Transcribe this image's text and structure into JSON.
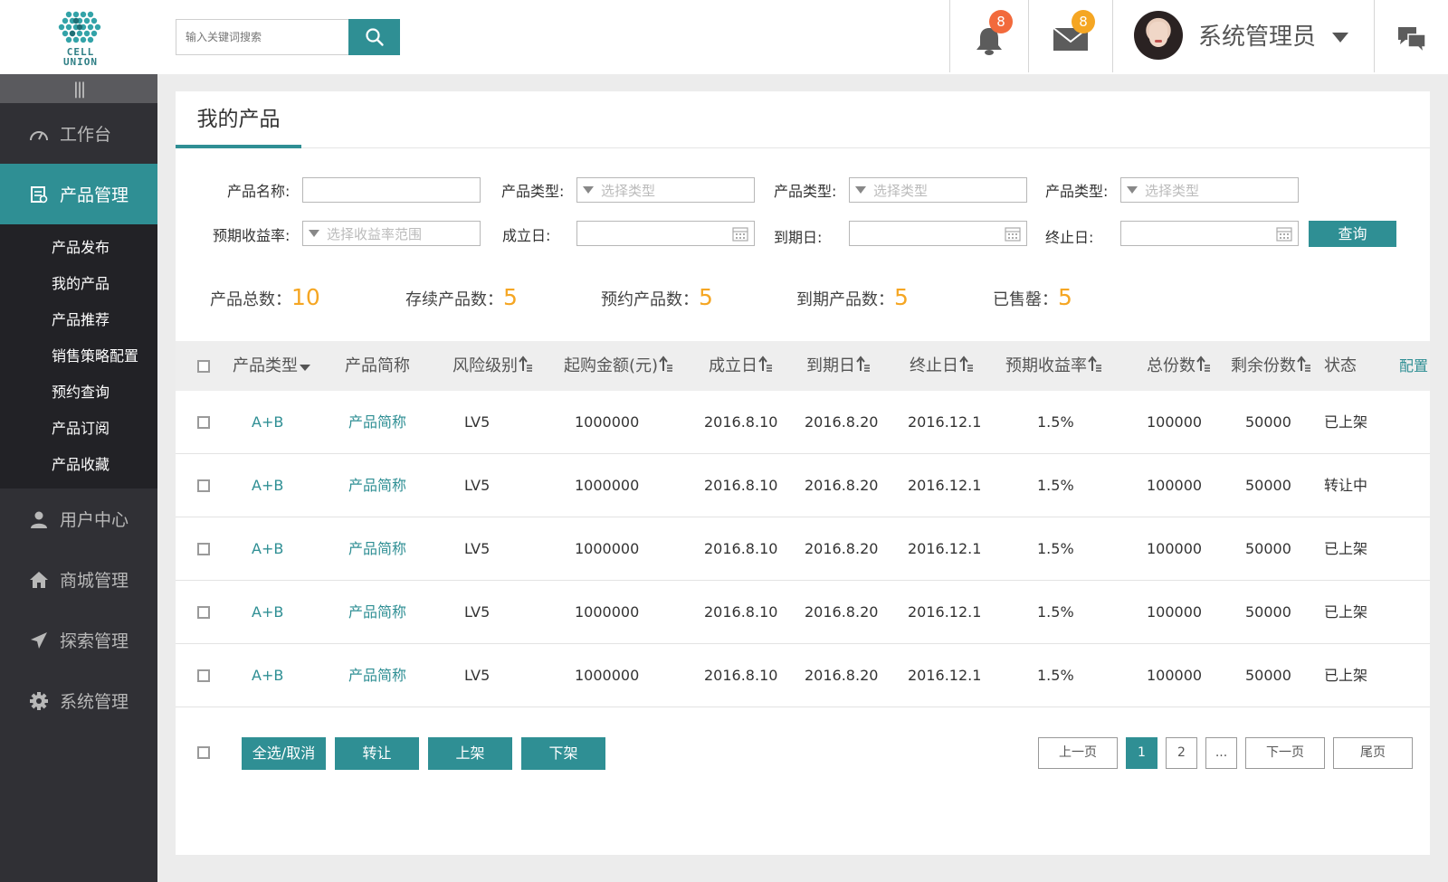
{
  "header": {
    "logo_text_1": "CELL",
    "logo_text_2": "UNION",
    "search_placeholder": "输入关键词搜索",
    "notifications_count": "8",
    "messages_count": "8",
    "user_name": "系统管理员"
  },
  "sidebar": {
    "items": [
      {
        "label": "工作台",
        "icon": "dashboard-icon"
      },
      {
        "label": "产品管理",
        "icon": "product-list-icon"
      },
      {
        "label": "用户中心",
        "icon": "user-icon"
      },
      {
        "label": "商城管理",
        "icon": "home-icon"
      },
      {
        "label": "探索管理",
        "icon": "send-icon"
      },
      {
        "label": "系统管理",
        "icon": "gear-icon"
      }
    ],
    "sub_items": [
      "产品发布",
      "我的产品",
      "产品推荐",
      "销售策略配置",
      "预约查询",
      "产品订阅",
      "产品收藏"
    ]
  },
  "page": {
    "title": "我的产品"
  },
  "filters": {
    "name_label": "产品名称:",
    "type_label": "产品类型:",
    "type_placeholder": "选择类型",
    "rate_label": "预期收益率:",
    "rate_placeholder": "选择收益率范围",
    "setup_label": "成立日:",
    "due_label": "到期日:",
    "end_label": "终止日:",
    "query_button": "查询"
  },
  "stats": [
    {
      "label": "产品总数：",
      "value": "10"
    },
    {
      "label": "存续产品数：",
      "value": "5"
    },
    {
      "label": "预约产品数：",
      "value": "5"
    },
    {
      "label": "到期产品数：",
      "value": "5"
    },
    {
      "label": "已售罄：",
      "value": "5"
    }
  ],
  "table": {
    "headers": [
      "产品类型",
      "产品简称",
      "风险级别",
      "起购金额(元)",
      "成立日",
      "到期日",
      "终止日",
      "预期收益率",
      "总份数",
      "剩余份数",
      "状态"
    ],
    "config_label": "配置",
    "rows": [
      [
        "A+B",
        "产品简称",
        "LV5",
        "1000000",
        "2016.8.10",
        "2016.8.20",
        "2016.12.1",
        "1.5%",
        "100000",
        "50000",
        "已上架"
      ],
      [
        "A+B",
        "产品简称",
        "LV5",
        "1000000",
        "2016.8.10",
        "2016.8.20",
        "2016.12.1",
        "1.5%",
        "100000",
        "50000",
        "转让中"
      ],
      [
        "A+B",
        "产品简称",
        "LV5",
        "1000000",
        "2016.8.10",
        "2016.8.20",
        "2016.12.1",
        "1.5%",
        "100000",
        "50000",
        "已上架"
      ],
      [
        "A+B",
        "产品简称",
        "LV5",
        "1000000",
        "2016.8.10",
        "2016.8.20",
        "2016.12.1",
        "1.5%",
        "100000",
        "50000",
        "已上架"
      ],
      [
        "A+B",
        "产品简称",
        "LV5",
        "1000000",
        "2016.8.10",
        "2016.8.20",
        "2016.12.1",
        "1.5%",
        "100000",
        "50000",
        "已上架"
      ]
    ]
  },
  "actions": {
    "select_all": "全选/取消",
    "transfer": "转让",
    "list": "上架",
    "delist": "下架"
  },
  "pagination": {
    "prev": "上一页",
    "pages": [
      "1",
      "2",
      "..."
    ],
    "current": "1",
    "next": "下一页",
    "last": "尾页"
  },
  "colors": {
    "accent": "#2f8f94",
    "highlight": "#f5a623",
    "badge_red": "#f26a3c",
    "sidebar_bg": "#303035"
  }
}
